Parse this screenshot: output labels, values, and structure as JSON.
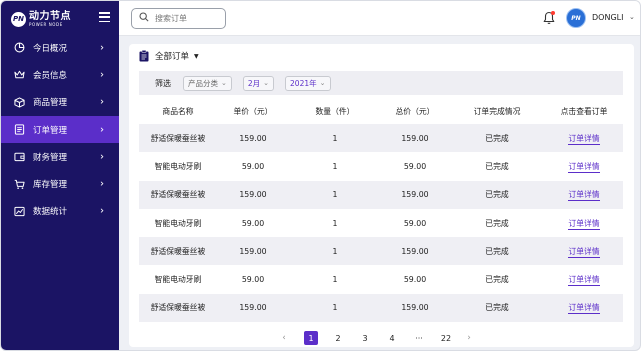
{
  "brand": {
    "logo_mark": "PN",
    "name_cn": "动力节点",
    "name_en": "POWER NODE"
  },
  "sidebar": {
    "items": [
      {
        "label": "今日概况",
        "icon": "pie-chart-icon",
        "active": false
      },
      {
        "label": "会员信息",
        "icon": "crown-icon",
        "active": false
      },
      {
        "label": "商品管理",
        "icon": "box-icon",
        "active": false
      },
      {
        "label": "订单管理",
        "icon": "list-icon",
        "active": true
      },
      {
        "label": "财务管理",
        "icon": "wallet-icon",
        "active": false
      },
      {
        "label": "库存管理",
        "icon": "cart-icon",
        "active": false
      },
      {
        "label": "数据统计",
        "icon": "line-chart-icon",
        "active": false
      }
    ]
  },
  "header": {
    "search_placeholder": "搜索订单",
    "username": "DONGLI",
    "avatar_text": "PN"
  },
  "orders": {
    "title": "全部订单",
    "filter_label": "筛选",
    "filters": [
      {
        "value": "产品分类",
        "accent": false
      },
      {
        "value": "2月",
        "accent": true
      },
      {
        "value": "2021年",
        "accent": true
      }
    ],
    "columns": [
      "商品名称",
      "单价（元）",
      "数量（件）",
      "总价（元）",
      "订单完成情况",
      "点击查看订单"
    ],
    "rows": [
      {
        "name": "舒适保暖蚕丝被",
        "price": "159.00",
        "qty": "1",
        "total": "159.00",
        "status": "已完成",
        "action": "订单详情"
      },
      {
        "name": "智能电动牙刷",
        "price": "59.00",
        "qty": "1",
        "total": "59.00",
        "status": "已完成",
        "action": "订单详情"
      },
      {
        "name": "舒适保暖蚕丝被",
        "price": "159.00",
        "qty": "1",
        "total": "159.00",
        "status": "已完成",
        "action": "订单详情"
      },
      {
        "name": "智能电动牙刷",
        "price": "59.00",
        "qty": "1",
        "total": "59.00",
        "status": "已完成",
        "action": "订单详情"
      },
      {
        "name": "舒适保暖蚕丝被",
        "price": "159.00",
        "qty": "1",
        "total": "159.00",
        "status": "已完成",
        "action": "订单详情"
      },
      {
        "name": "智能电动牙刷",
        "price": "59.00",
        "qty": "1",
        "total": "59.00",
        "status": "已完成",
        "action": "订单详情"
      },
      {
        "name": "舒适保暖蚕丝被",
        "price": "159.00",
        "qty": "1",
        "total": "159.00",
        "status": "已完成",
        "action": "订单详情"
      }
    ],
    "pagination": {
      "prev": "‹",
      "pages": [
        "1",
        "2",
        "3",
        "4",
        "···",
        "22"
      ],
      "current": "1",
      "next": "›"
    }
  },
  "colors": {
    "sidebar_bg": "#1b1464",
    "accent": "#5b2ec9",
    "bell_dot": "#ff3b30",
    "avatar": "#2a6fd6"
  }
}
